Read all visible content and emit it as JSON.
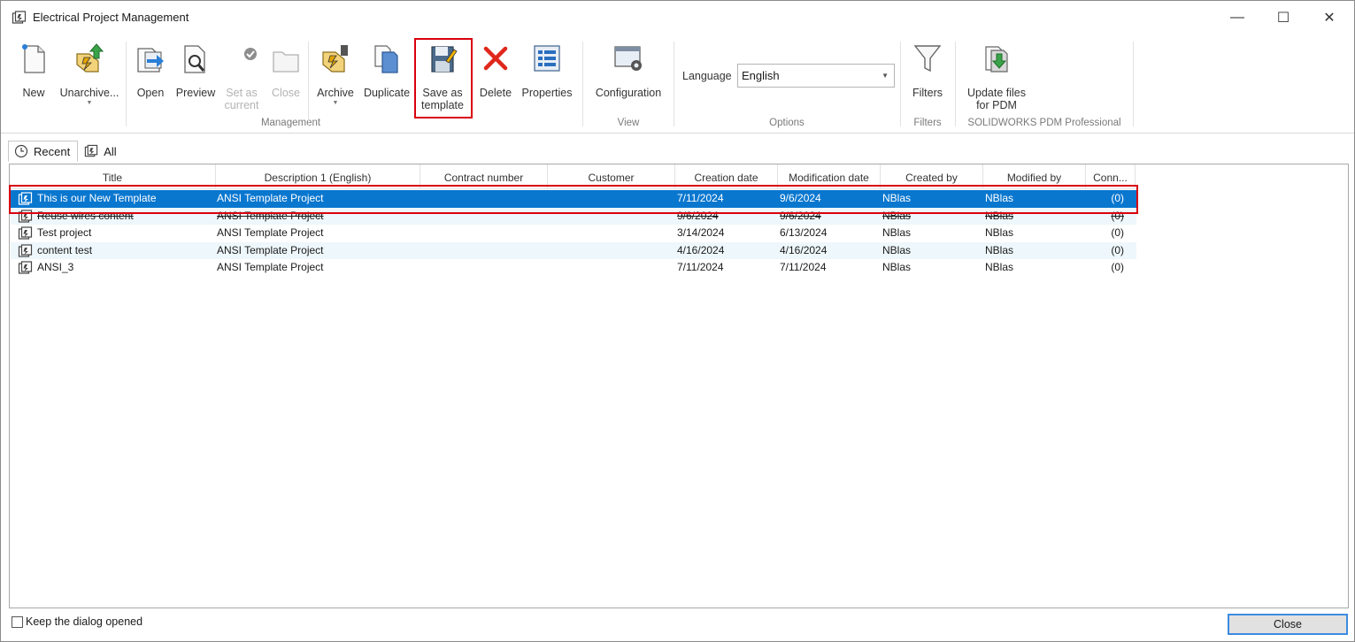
{
  "window": {
    "title": "Electrical Project Management",
    "minimize": "—",
    "maximize": "☐",
    "close": "✕"
  },
  "ribbon": {
    "management": {
      "label": "Management",
      "buttons": {
        "new": "New",
        "unarchive": "Unarchive...",
        "open": "Open",
        "preview": "Preview",
        "set_as_current_1": "Set as",
        "set_as_current_2": "current",
        "close": "Close",
        "archive": "Archive",
        "duplicate": "Duplicate",
        "save_as_template_1": "Save as",
        "save_as_template_2": "template",
        "delete": "Delete",
        "properties": "Properties"
      }
    },
    "view": {
      "label": "View",
      "configuration": "Configuration"
    },
    "options": {
      "label": "Options",
      "language_label": "Language",
      "language_value": "English"
    },
    "filters": {
      "label": "Filters",
      "filters": "Filters"
    },
    "pdm": {
      "label": "SOLIDWORKS PDM Professional",
      "update_1": "Update files",
      "update_2": "for PDM"
    }
  },
  "tabs": [
    {
      "label": "Recent",
      "active": true
    },
    {
      "label": "All",
      "active": false
    }
  ],
  "table": {
    "columns": [
      "Title",
      "Description 1 (English)",
      "Contract number",
      "Customer",
      "Creation date",
      "Modification date",
      "Created by",
      "Modified by",
      "Conn..."
    ],
    "rows": [
      {
        "title": "This is our New Template",
        "description": "ANSI Template Project",
        "contract": "",
        "customer": "",
        "created": "7/11/2024",
        "modified": "9/6/2024",
        "created_by": "NBlas",
        "modified_by": "NBlas",
        "conn": "(0)"
      },
      {
        "title": "Reuse wires content",
        "description": "ANSI Template Project",
        "contract": "",
        "customer": "",
        "created": "9/6/2024",
        "modified": "9/6/2024",
        "created_by": "NBlas",
        "modified_by": "NBlas",
        "conn": "(0)"
      },
      {
        "title": "Test project",
        "description": "ANSI Template Project",
        "contract": "",
        "customer": "",
        "created": "3/14/2024",
        "modified": "6/13/2024",
        "created_by": "NBlas",
        "modified_by": "NBlas",
        "conn": "(0)"
      },
      {
        "title": "content test",
        "description": "ANSI Template Project",
        "contract": "",
        "customer": "",
        "created": "4/16/2024",
        "modified": "4/16/2024",
        "created_by": "NBlas",
        "modified_by": "NBlas",
        "conn": "(0)"
      },
      {
        "title": "ANSI_3",
        "description": "ANSI Template Project",
        "contract": "",
        "customer": "",
        "created": "7/11/2024",
        "modified": "7/11/2024",
        "created_by": "NBlas",
        "modified_by": "NBlas",
        "conn": "(0)"
      }
    ]
  },
  "footer": {
    "keep_opened": "Keep the dialog opened",
    "close_button": "Close"
  },
  "colors": {
    "selection": "#0a77cf",
    "highlight": "#d9000d",
    "alt_row": "#eef7fb"
  }
}
